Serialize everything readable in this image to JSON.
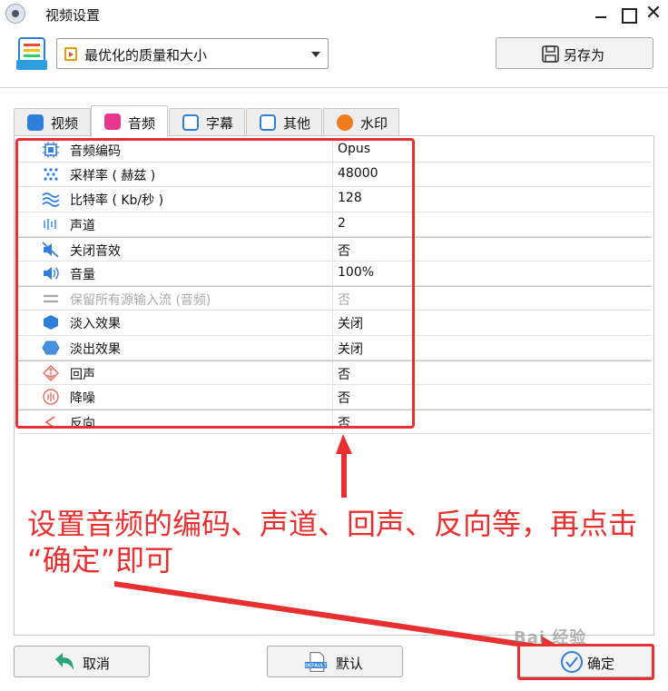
{
  "window": {
    "title": "视频设置",
    "close_glyph": "✕"
  },
  "preset": {
    "selected": "最优化的质量和大小",
    "save_as_label": "另存为"
  },
  "tabs": [
    {
      "label": "视频",
      "icon": "video-tab-icon",
      "color": "#2f7fd8"
    },
    {
      "label": "音频",
      "icon": "music-note-icon",
      "color": "#e8368f"
    },
    {
      "label": "字幕",
      "icon": "subtitle-icon",
      "color": "#2f7fd8"
    },
    {
      "label": "其他",
      "icon": "sliders-icon",
      "color": "#2f7fd8"
    },
    {
      "label": "水印",
      "icon": "new-badge-icon",
      "color": "#f07a1e"
    }
  ],
  "audio_settings": [
    {
      "name": "音频编码",
      "value": "Opus",
      "icon": "chip-icon"
    },
    {
      "name": "采样率 ( 赫兹 )",
      "value": "48000",
      "icon": "sample-rate-icon"
    },
    {
      "name": "比特率 ( Kb/秒 )",
      "value": "128",
      "icon": "bitrate-wave-icon"
    },
    {
      "name": "声道",
      "value": "2",
      "icon": "channel-icon"
    },
    {
      "name": "关闭音效",
      "value": "否",
      "icon": "speaker-muted-icon"
    },
    {
      "name": "音量",
      "value": "100%",
      "icon": "speaker-volume-icon"
    },
    {
      "name": "保留所有源输入流 (音频)",
      "value": "否",
      "icon": "equals-icon",
      "disabled": true
    },
    {
      "name": "淡入效果",
      "value": "关闭",
      "icon": "hexagon-filled-icon"
    },
    {
      "name": "淡出效果",
      "value": "关闭",
      "icon": "hexagon-outline-icon"
    },
    {
      "name": "回声",
      "value": "否",
      "icon": "echo-icon"
    },
    {
      "name": "降噪",
      "value": "否",
      "icon": "noise-reduction-icon"
    },
    {
      "name": "反向",
      "value": "否",
      "icon": "reverse-icon"
    }
  ],
  "annotation": {
    "line1": "设置音频的编码、声道、回声、反向等，再点击",
    "line2": "“确定”即可"
  },
  "footer": {
    "cancel_label": "取消",
    "default_label": "默认",
    "default_icon_text": "DEFAULT",
    "ok_label": "确定"
  },
  "watermark": "Bai 经验",
  "colors": {
    "annotation_red": "#e83030",
    "accent_blue": "#2f7fd8",
    "cancel_green": "#2aa37a"
  }
}
